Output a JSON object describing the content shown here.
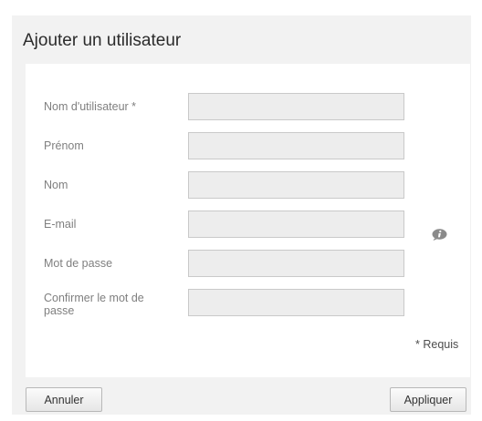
{
  "dialog": {
    "title": "Ajouter un utilisateur"
  },
  "form": {
    "fields": [
      {
        "label": "Nom d'utilisateur *",
        "value": "",
        "placeholder": ""
      },
      {
        "label": "Prénom",
        "value": "",
        "placeholder": ""
      },
      {
        "label": "Nom",
        "value": "",
        "placeholder": ""
      },
      {
        "label": "E-mail",
        "value": "",
        "placeholder": ""
      },
      {
        "label": "Mot de passe",
        "value": "",
        "placeholder": ""
      },
      {
        "label": "Confirmer le mot de passe",
        "value": "",
        "placeholder": ""
      }
    ],
    "email_info_icon": "info-icon",
    "required_note": "* Requis"
  },
  "buttons": {
    "cancel_label": "Annuler",
    "apply_label": "Appliquer"
  },
  "colors": {
    "panel_background": "#f2f2f2",
    "field_background": "#ededed",
    "label_text": "#7f7f7f",
    "icon": "#8a8a8a"
  }
}
